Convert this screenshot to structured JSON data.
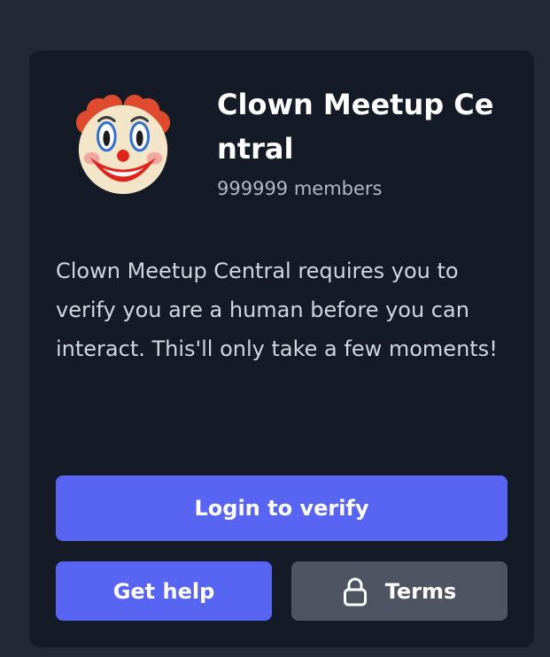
{
  "server": {
    "name": "Clown Meetup Central",
    "members": "999999 members",
    "avatar_icon": "clown-face-icon"
  },
  "description": "Clown Meetup Central requires you to verify you are a human before you can interact. This'll only take a few moments!",
  "buttons": {
    "login_label": "Login to verify",
    "help_label": "Get help",
    "terms_label": "Terms",
    "terms_icon": "lock-icon"
  },
  "colors": {
    "page_background": "#212836",
    "card_background": "#141a26",
    "primary": "#5865f2",
    "secondary": "#4e5461"
  }
}
